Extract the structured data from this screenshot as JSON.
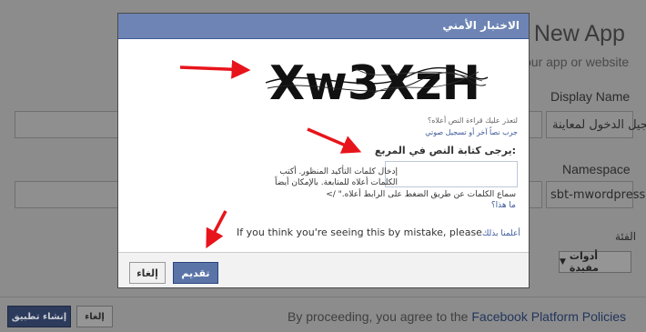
{
  "background": {
    "title": "a New App",
    "subtitle": "our app or website",
    "display_name_label": "Display Name",
    "display_name_value": "تسجيل الدخول لمعاينة",
    "namespace_label": "Namespace",
    "namespace_value": "sbt-mwordpress",
    "category_label": "الفئة",
    "category_value": "أدوات مفيدة",
    "create_button": "إنشاء تطبيق",
    "cancel_button": "إلغاء",
    "footer_text": "By proceeding, you agree to the ",
    "footer_link": "Facebook Platform Policies"
  },
  "modal": {
    "title": "الاختبار الأمني",
    "captcha_text": "Xw3XzH",
    "cant_read": "لتعذر عليك قراءة النص أعلاه؟",
    "try_another": "جرب نصاً آخر أو تسجيل صوتي",
    "prompt": "يرجى كتابة النص في المربع:",
    "captcha_input_value": "",
    "instructions": "إدخال كلمات التأكيد المنظور. أكتب الكلمات أعلاه للمتابعة. بالإمكان أيضاً",
    "audio_line": "سماع الكلمات عن طريق الضغط على الرابط أعلاه.\" />",
    "what_link": "ما هذا؟",
    "mistake_text": "If you think you're seeing this by mistake, please",
    "mistake_link": "أعلمنا بذلك",
    "submit_button": "تقديم",
    "cancel_button": "إلغاء"
  },
  "colors": {
    "header_blue": "#6d84b4",
    "link_blue": "#3b5998",
    "arrow_red": "#e8141b"
  }
}
